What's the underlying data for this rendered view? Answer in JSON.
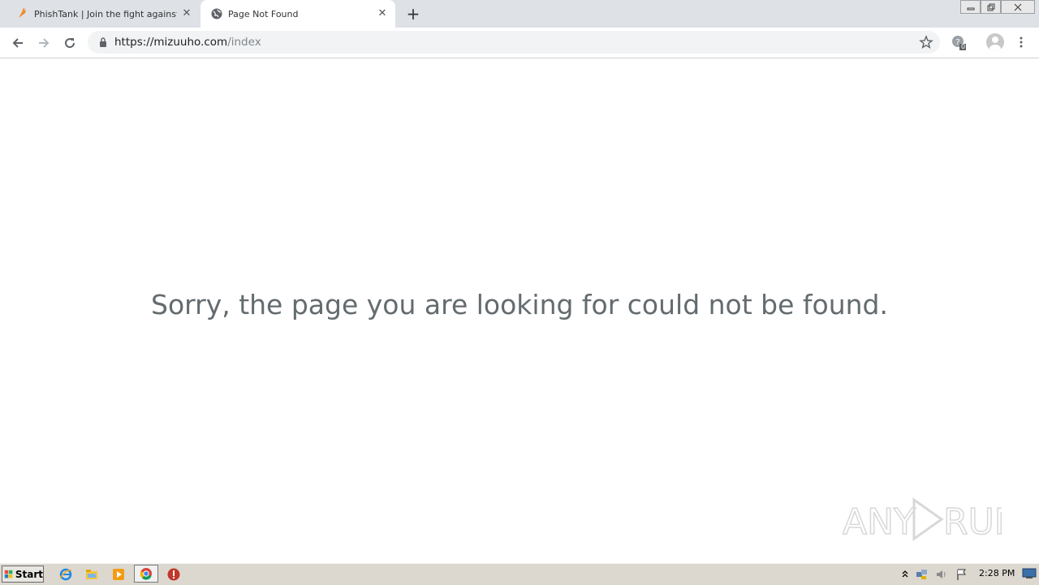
{
  "browser": {
    "tabs": [
      {
        "title": "PhishTank | Join the fight against phishing",
        "icon": "phishtank-icon",
        "active": false
      },
      {
        "title": "Page Not Found",
        "icon": "globe-icon",
        "active": true
      }
    ],
    "address_bar": {
      "url_host": "https://mizuuho.com",
      "url_path": "/index"
    },
    "extension_badge": "0"
  },
  "page": {
    "message": "Sorry, the page you are looking for could not be found."
  },
  "watermark": "ANY RUN",
  "taskbar": {
    "start_label": "Start",
    "clock": "2:28 PM"
  },
  "colors": {
    "tabstrip": "#dee1e6",
    "message_text": "#636b6f",
    "taskbar": "#dcd8d0"
  }
}
